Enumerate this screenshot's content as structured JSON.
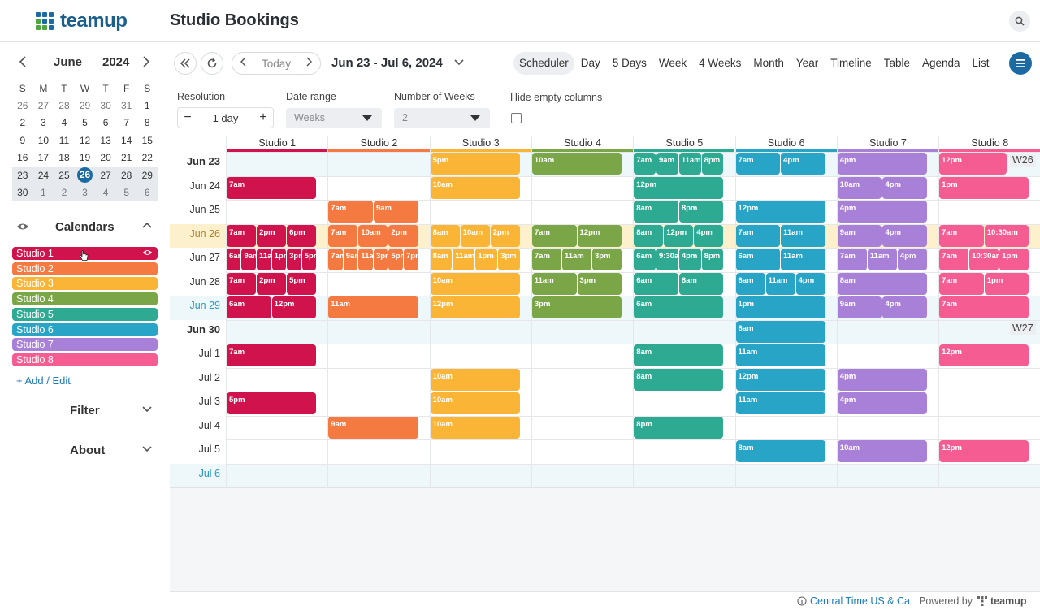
{
  "app": {
    "logo_text": "teamup",
    "title": "Studio Bookings"
  },
  "colors": {
    "brand": "#1b6aa1",
    "studio1": "#d0134d",
    "studio2": "#f47a42",
    "studio3": "#fbb536",
    "studio4": "#7ba647",
    "studio5": "#2eaa92",
    "studio6": "#27a4c6",
    "studio7": "#a980d8",
    "studio8": "#f55d92"
  },
  "mini_calendar": {
    "month": "June",
    "year": "2024",
    "dow": [
      "S",
      "M",
      "T",
      "W",
      "T",
      "F",
      "S"
    ],
    "weeks": [
      [
        "26",
        "27",
        "28",
        "29",
        "30",
        "31",
        "1"
      ],
      [
        "2",
        "3",
        "4",
        "5",
        "6",
        "7",
        "8"
      ],
      [
        "9",
        "10",
        "11",
        "12",
        "13",
        "14",
        "15"
      ],
      [
        "16",
        "17",
        "18",
        "19",
        "20",
        "21",
        "22"
      ],
      [
        "23",
        "24",
        "25",
        "26",
        "27",
        "28",
        "29"
      ],
      [
        "30",
        "1",
        "2",
        "3",
        "4",
        "5",
        "6"
      ]
    ],
    "today": "26"
  },
  "sidebar": {
    "calendars_title": "Calendars",
    "calendars": [
      {
        "label": "Studio 1"
      },
      {
        "label": "Studio 2"
      },
      {
        "label": "Studio 3"
      },
      {
        "label": "Studio 4"
      },
      {
        "label": "Studio 5"
      },
      {
        "label": "Studio 6"
      },
      {
        "label": "Studio 7"
      },
      {
        "label": "Studio 8"
      }
    ],
    "add_edit": "+ Add / Edit",
    "filter": "Filter",
    "about": "About"
  },
  "toolbar": {
    "today": "Today",
    "range": "Jun 23 - Jul 6, 2024",
    "views": [
      "Scheduler",
      "Day",
      "5 Days",
      "Week",
      "4 Weeks",
      "Month",
      "Year",
      "Timeline",
      "Table",
      "Agenda",
      "List"
    ],
    "active_view": "Scheduler"
  },
  "settings": {
    "resolution_label": "Resolution",
    "resolution_minus": "−",
    "resolution_value": "1 day",
    "resolution_plus": "+",
    "date_range_label": "Date range",
    "date_range_value": "Weeks",
    "weeks_label": "Number of Weeks",
    "weeks_value": "2",
    "hide_label": "Hide empty columns"
  },
  "columns": [
    "Studio 1",
    "Studio 2",
    "Studio 3",
    "Studio 4",
    "Studio 5",
    "Studio 6",
    "Studio 7",
    "Studio 8"
  ],
  "rows": [
    {
      "label": "Jun 23",
      "bold": true
    },
    {
      "label": "Jun 24"
    },
    {
      "label": "Jun 25"
    },
    {
      "label": "Jun 26",
      "today": true
    },
    {
      "label": "Jun 27"
    },
    {
      "label": "Jun 28"
    },
    {
      "label": "Jun 29",
      "sat": true
    },
    {
      "label": "Jun 30",
      "bold": true
    },
    {
      "label": "Jul 1"
    },
    {
      "label": "Jul 2"
    },
    {
      "label": "Jul 3"
    },
    {
      "label": "Jul 4"
    },
    {
      "label": "Jul 5"
    },
    {
      "label": "Jul 6",
      "sat": true
    }
  ],
  "week_labels": [
    {
      "label": "W26",
      "row": 0
    },
    {
      "label": "W27",
      "row": 7
    }
  ],
  "events": [
    {
      "c": 2,
      "r": 0,
      "s": 0,
      "w": 1,
      "t": "5pm"
    },
    {
      "c": 3,
      "r": 0,
      "s": 0,
      "w": 1,
      "t": "10am"
    },
    {
      "c": 4,
      "r": 0,
      "s": 0,
      "w": 0.25,
      "t": "7am"
    },
    {
      "c": 4,
      "r": 0,
      "s": 0.25,
      "w": 0.25,
      "t": "9am"
    },
    {
      "c": 4,
      "r": 0,
      "s": 0.5,
      "w": 0.25,
      "t": "11am"
    },
    {
      "c": 4,
      "r": 0,
      "s": 0.75,
      "w": 0.25,
      "t": "8pm"
    },
    {
      "c": 5,
      "r": 0,
      "s": 0,
      "w": 0.5,
      "t": "7am"
    },
    {
      "c": 5,
      "r": 0,
      "s": 0.5,
      "w": 0.5,
      "t": "4pm"
    },
    {
      "c": 6,
      "r": 0,
      "s": 0,
      "w": 1,
      "t": "4pm"
    },
    {
      "c": 7,
      "r": 0,
      "s": 0,
      "w": 0.75,
      "t": "12pm"
    },
    {
      "c": 0,
      "r": 1,
      "s": 0,
      "w": 1,
      "t": "7am"
    },
    {
      "c": 2,
      "r": 1,
      "s": 0,
      "w": 1,
      "t": "10am"
    },
    {
      "c": 4,
      "r": 1,
      "s": 0,
      "w": 1,
      "t": "12pm"
    },
    {
      "c": 6,
      "r": 1,
      "s": 0,
      "w": 0.5,
      "t": "10am"
    },
    {
      "c": 6,
      "r": 1,
      "s": 0.5,
      "w": 0.5,
      "t": "4pm"
    },
    {
      "c": 7,
      "r": 1,
      "s": 0,
      "w": 1,
      "t": "1pm"
    },
    {
      "c": 1,
      "r": 2,
      "s": 0,
      "w": 0.5,
      "t": "7am"
    },
    {
      "c": 1,
      "r": 2,
      "s": 0.5,
      "w": 0.5,
      "t": "9am"
    },
    {
      "c": 4,
      "r": 2,
      "s": 0,
      "w": 0.5,
      "t": "8am"
    },
    {
      "c": 4,
      "r": 2,
      "s": 0.5,
      "w": 0.5,
      "t": "8pm"
    },
    {
      "c": 5,
      "r": 2,
      "s": 0,
      "w": 1,
      "t": "12pm"
    },
    {
      "c": 6,
      "r": 2,
      "s": 0,
      "w": 1,
      "t": "4pm"
    },
    {
      "c": 0,
      "r": 3,
      "s": 0,
      "w": 0.333,
      "t": "7am"
    },
    {
      "c": 0,
      "r": 3,
      "s": 0.333,
      "w": 0.333,
      "t": "2pm"
    },
    {
      "c": 0,
      "r": 3,
      "s": 0.666,
      "w": 0.334,
      "t": "6pm"
    },
    {
      "c": 1,
      "r": 3,
      "s": 0,
      "w": 0.333,
      "t": "7am"
    },
    {
      "c": 1,
      "r": 3,
      "s": 0.333,
      "w": 0.333,
      "t": "10am"
    },
    {
      "c": 1,
      "r": 3,
      "s": 0.666,
      "w": 0.334,
      "t": "2pm"
    },
    {
      "c": 2,
      "r": 3,
      "s": 0,
      "w": 0.333,
      "t": "8am"
    },
    {
      "c": 2,
      "r": 3,
      "s": 0.333,
      "w": 0.333,
      "t": "10am"
    },
    {
      "c": 2,
      "r": 3,
      "s": 0.666,
      "w": 0.334,
      "t": "2pm"
    },
    {
      "c": 3,
      "r": 3,
      "s": 0,
      "w": 0.5,
      "t": "7am"
    },
    {
      "c": 3,
      "r": 3,
      "s": 0.5,
      "w": 0.5,
      "t": "12pm"
    },
    {
      "c": 4,
      "r": 3,
      "s": 0,
      "w": 0.333,
      "t": "8am"
    },
    {
      "c": 4,
      "r": 3,
      "s": 0.333,
      "w": 0.333,
      "t": "12pm"
    },
    {
      "c": 4,
      "r": 3,
      "s": 0.666,
      "w": 0.334,
      "t": "4pm"
    },
    {
      "c": 5,
      "r": 3,
      "s": 0,
      "w": 0.5,
      "t": "7am"
    },
    {
      "c": 5,
      "r": 3,
      "s": 0.5,
      "w": 0.5,
      "t": "11am"
    },
    {
      "c": 6,
      "r": 3,
      "s": 0,
      "w": 0.5,
      "t": "9am"
    },
    {
      "c": 6,
      "r": 3,
      "s": 0.5,
      "w": 0.5,
      "t": "4pm"
    },
    {
      "c": 7,
      "r": 3,
      "s": 0,
      "w": 0.5,
      "t": "7am"
    },
    {
      "c": 7,
      "r": 3,
      "s": 0.5,
      "w": 0.5,
      "t": "10:30am"
    },
    {
      "c": 0,
      "r": 4,
      "s": 0,
      "w": 0.166,
      "t": "6am"
    },
    {
      "c": 0,
      "r": 4,
      "s": 0.166,
      "w": 0.166,
      "t": "9am"
    },
    {
      "c": 0,
      "r": 4,
      "s": 0.333,
      "w": 0.166,
      "t": "11am"
    },
    {
      "c": 0,
      "r": 4,
      "s": 0.5,
      "w": 0.166,
      "t": "1pm"
    },
    {
      "c": 0,
      "r": 4,
      "s": 0.666,
      "w": 0.166,
      "t": "3pm"
    },
    {
      "c": 0,
      "r": 4,
      "s": 0.833,
      "w": 0.167,
      "t": "5pm"
    },
    {
      "c": 1,
      "r": 4,
      "s": 0,
      "w": 0.166,
      "t": "7am"
    },
    {
      "c": 1,
      "r": 4,
      "s": 0.166,
      "w": 0.166,
      "t": "9am"
    },
    {
      "c": 1,
      "r": 4,
      "s": 0.333,
      "w": 0.166,
      "t": "11am"
    },
    {
      "c": 1,
      "r": 4,
      "s": 0.5,
      "w": 0.166,
      "t": "3pm"
    },
    {
      "c": 1,
      "r": 4,
      "s": 0.666,
      "w": 0.166,
      "t": "5pm"
    },
    {
      "c": 1,
      "r": 4,
      "s": 0.833,
      "w": 0.167,
      "t": "7pm"
    },
    {
      "c": 2,
      "r": 4,
      "s": 0,
      "w": 0.25,
      "t": "8am"
    },
    {
      "c": 2,
      "r": 4,
      "s": 0.25,
      "w": 0.25,
      "t": "11am"
    },
    {
      "c": 2,
      "r": 4,
      "s": 0.5,
      "w": 0.25,
      "t": "1pm"
    },
    {
      "c": 2,
      "r": 4,
      "s": 0.75,
      "w": 0.25,
      "t": "3pm"
    },
    {
      "c": 3,
      "r": 4,
      "s": 0,
      "w": 0.333,
      "t": "7am"
    },
    {
      "c": 3,
      "r": 4,
      "s": 0.333,
      "w": 0.333,
      "t": "11am"
    },
    {
      "c": 3,
      "r": 4,
      "s": 0.666,
      "w": 0.334,
      "t": "3pm"
    },
    {
      "c": 4,
      "r": 4,
      "s": 0,
      "w": 0.25,
      "t": "6am"
    },
    {
      "c": 4,
      "r": 4,
      "s": 0.25,
      "w": 0.25,
      "t": "9:30am"
    },
    {
      "c": 4,
      "r": 4,
      "s": 0.5,
      "w": 0.25,
      "t": "4pm"
    },
    {
      "c": 4,
      "r": 4,
      "s": 0.75,
      "w": 0.25,
      "t": "8pm"
    },
    {
      "c": 5,
      "r": 4,
      "s": 0,
      "w": 0.5,
      "t": "6am"
    },
    {
      "c": 5,
      "r": 4,
      "s": 0.5,
      "w": 0.5,
      "t": "11am"
    },
    {
      "c": 6,
      "r": 4,
      "s": 0,
      "w": 0.333,
      "t": "7am"
    },
    {
      "c": 6,
      "r": 4,
      "s": 0.333,
      "w": 0.333,
      "t": "11am"
    },
    {
      "c": 6,
      "r": 4,
      "s": 0.666,
      "w": 0.334,
      "t": "4pm"
    },
    {
      "c": 7,
      "r": 4,
      "s": 0,
      "w": 0.333,
      "t": "7am"
    },
    {
      "c": 7,
      "r": 4,
      "s": 0.333,
      "w": 0.333,
      "t": "10:30am"
    },
    {
      "c": 7,
      "r": 4,
      "s": 0.666,
      "w": 0.334,
      "t": "1pm"
    },
    {
      "c": 0,
      "r": 5,
      "s": 0,
      "w": 0.333,
      "t": "7am"
    },
    {
      "c": 0,
      "r": 5,
      "s": 0.333,
      "w": 0.333,
      "t": "2pm"
    },
    {
      "c": 0,
      "r": 5,
      "s": 0.666,
      "w": 0.334,
      "t": "5pm"
    },
    {
      "c": 2,
      "r": 5,
      "s": 0,
      "w": 1,
      "t": "10am"
    },
    {
      "c": 3,
      "r": 5,
      "s": 0,
      "w": 0.5,
      "t": "11am"
    },
    {
      "c": 3,
      "r": 5,
      "s": 0.5,
      "w": 0.5,
      "t": "3pm"
    },
    {
      "c": 4,
      "r": 5,
      "s": 0,
      "w": 0.5,
      "t": "6am"
    },
    {
      "c": 4,
      "r": 5,
      "s": 0.5,
      "w": 0.5,
      "t": "8am"
    },
    {
      "c": 5,
      "r": 5,
      "s": 0,
      "w": 0.333,
      "t": "6am"
    },
    {
      "c": 5,
      "r": 5,
      "s": 0.333,
      "w": 0.333,
      "t": "11am"
    },
    {
      "c": 5,
      "r": 5,
      "s": 0.666,
      "w": 0.334,
      "t": "4pm"
    },
    {
      "c": 6,
      "r": 5,
      "s": 0,
      "w": 1,
      "t": "8am"
    },
    {
      "c": 7,
      "r": 5,
      "s": 0,
      "w": 0.5,
      "t": "7am"
    },
    {
      "c": 7,
      "r": 5,
      "s": 0.5,
      "w": 0.5,
      "t": "1pm"
    },
    {
      "c": 0,
      "r": 6,
      "s": 0,
      "w": 0.5,
      "t": "6am"
    },
    {
      "c": 0,
      "r": 6,
      "s": 0.5,
      "w": 0.5,
      "t": "12pm"
    },
    {
      "c": 1,
      "r": 6,
      "s": 0,
      "w": 1,
      "t": "11am"
    },
    {
      "c": 2,
      "r": 6,
      "s": 0,
      "w": 1,
      "t": "12pm"
    },
    {
      "c": 3,
      "r": 6,
      "s": 0,
      "w": 1,
      "t": "3pm"
    },
    {
      "c": 4,
      "r": 6,
      "s": 0,
      "w": 1,
      "t": "6am"
    },
    {
      "c": 5,
      "r": 6,
      "s": 0,
      "w": 1,
      "t": "1pm"
    },
    {
      "c": 6,
      "r": 6,
      "s": 0,
      "w": 0.5,
      "t": "9am"
    },
    {
      "c": 6,
      "r": 6,
      "s": 0.5,
      "w": 0.5,
      "t": "4pm"
    },
    {
      "c": 7,
      "r": 6,
      "s": 0,
      "w": 1,
      "t": "7am"
    },
    {
      "c": 5,
      "r": 7,
      "s": 0,
      "w": 1,
      "t": "6am"
    },
    {
      "c": 0,
      "r": 8,
      "s": 0,
      "w": 1,
      "t": "7am"
    },
    {
      "c": 4,
      "r": 8,
      "s": 0,
      "w": 1,
      "t": "8am"
    },
    {
      "c": 5,
      "r": 8,
      "s": 0,
      "w": 1,
      "t": "11am"
    },
    {
      "c": 7,
      "r": 8,
      "s": 0,
      "w": 1,
      "t": "12pm"
    },
    {
      "c": 2,
      "r": 9,
      "s": 0,
      "w": 1,
      "t": "10am"
    },
    {
      "c": 4,
      "r": 9,
      "s": 0,
      "w": 1,
      "t": "8am"
    },
    {
      "c": 5,
      "r": 9,
      "s": 0,
      "w": 1,
      "t": "12pm"
    },
    {
      "c": 6,
      "r": 9,
      "s": 0,
      "w": 1,
      "t": "4pm"
    },
    {
      "c": 0,
      "r": 10,
      "s": 0,
      "w": 1,
      "t": "5pm"
    },
    {
      "c": 2,
      "r": 10,
      "s": 0,
      "w": 1,
      "t": "10am"
    },
    {
      "c": 5,
      "r": 10,
      "s": 0,
      "w": 1,
      "t": "11am"
    },
    {
      "c": 6,
      "r": 10,
      "s": 0,
      "w": 1,
      "t": "4pm"
    },
    {
      "c": 1,
      "r": 11,
      "s": 0,
      "w": 1,
      "t": "9am"
    },
    {
      "c": 2,
      "r": 11,
      "s": 0,
      "w": 1,
      "t": "10am"
    },
    {
      "c": 4,
      "r": 11,
      "s": 0,
      "w": 1,
      "t": "8pm"
    },
    {
      "c": 5,
      "r": 12,
      "s": 0,
      "w": 1,
      "t": "8am"
    },
    {
      "c": 6,
      "r": 12,
      "s": 0,
      "w": 1,
      "t": "10am"
    },
    {
      "c": 7,
      "r": 12,
      "s": 0,
      "w": 1,
      "t": "12pm"
    }
  ],
  "footer": {
    "timezone": "Central Time US & Ca",
    "powered": "Powered by",
    "brand": "teamup"
  }
}
